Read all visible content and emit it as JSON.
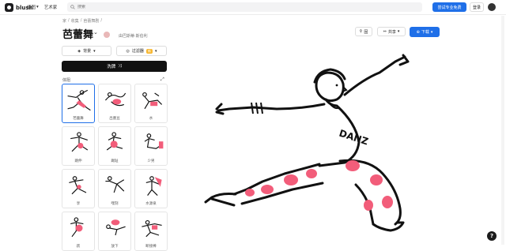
{
  "app": {
    "name": "blush"
  },
  "nav": {
    "items": [
      "插图",
      "艺术家"
    ]
  },
  "search": {
    "placeholder": "搜索"
  },
  "header": {
    "pro_label": "尝试专业免费",
    "login_label": "登录"
  },
  "breadcrumb": [
    "家",
    "收集",
    "芭蕾舞剧"
  ],
  "page": {
    "title": "芭蕾舞",
    "author": "由巴斯蒂·斯伯利"
  },
  "actions": {
    "pin_label": "固",
    "share_label": "共享",
    "download_label": "下载"
  },
  "controls": {
    "background_label": "背景",
    "filter_label": "过滤器",
    "filter_badge": "新",
    "shuffle_label": "洗牌"
  },
  "poses": {
    "label": "体阻",
    "items": [
      {
        "caption": "芭蕾舞"
      },
      {
        "caption": "出墨豆"
      },
      {
        "caption": "水"
      },
      {
        "caption": "跳伸"
      },
      {
        "caption": "踢趾"
      },
      {
        "caption": "少男"
      },
      {
        "caption": "享"
      },
      {
        "caption": "嘿刻"
      },
      {
        "caption": "水源泉"
      },
      {
        "caption": "跃"
      },
      {
        "caption": "放下"
      },
      {
        "caption": "断接棒"
      }
    ]
  },
  "illustration": {
    "shirt_text": "DANZ"
  },
  "colors": {
    "accent": "#1f6fe8",
    "pattern": "#f25d7a",
    "ink": "#111111"
  }
}
